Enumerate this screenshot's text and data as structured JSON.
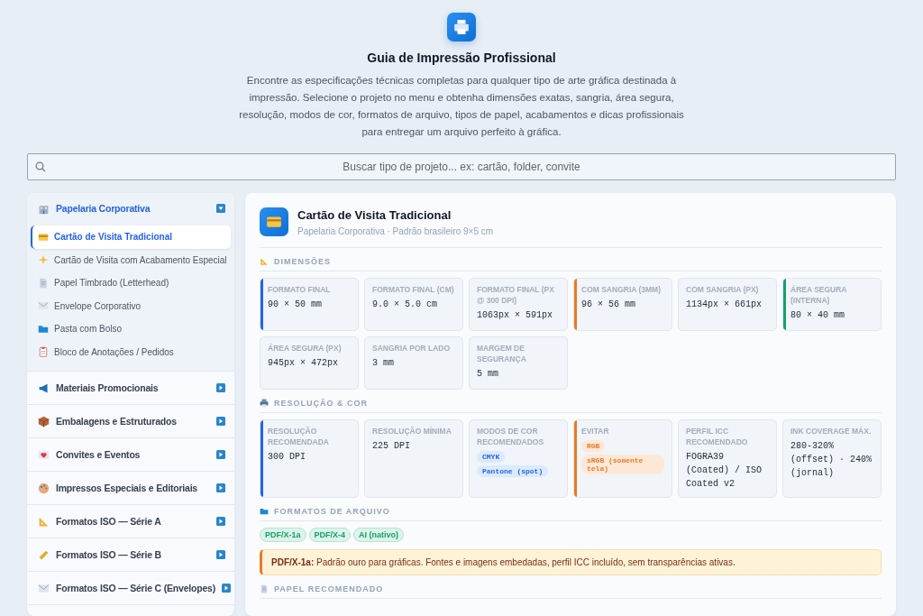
{
  "header": {
    "title": "Guia de Impressão Profissional",
    "intro": "Encontre as especificações técnicas completas para qualquer tipo de arte gráfica destinada à impressão. Selecione o projeto no menu e obtenha dimensões exatas, sangria, área segura, resolução, modos de cor, formatos de arquivo, tipos de papel, acabamentos e dicas profissionais para entregar um arquivo perfeito à gráfica."
  },
  "search": {
    "placeholder": "Buscar tipo de projeto... ex: cartão, folder, convite"
  },
  "sidebar": {
    "groups": [
      {
        "label": "Papelaria Corporativa",
        "expanded": true,
        "items": [
          {
            "label": "Cartão de Visita Tradicional",
            "selected": true
          },
          {
            "label": "Cartão de Visita com Acabamento Especial",
            "selected": false
          },
          {
            "label": "Papel Timbrado (Letterhead)",
            "selected": false
          },
          {
            "label": "Envelope Corporativo",
            "selected": false
          },
          {
            "label": "Pasta com Bolso",
            "selected": false
          },
          {
            "label": "Bloco de Anotações / Pedidos",
            "selected": false
          }
        ]
      },
      {
        "label": "Materiais Promocionais",
        "expanded": false
      },
      {
        "label": "Embalagens e Estruturados",
        "expanded": false
      },
      {
        "label": "Convites e Eventos",
        "expanded": false
      },
      {
        "label": "Impressos Especiais e Editoriais",
        "expanded": false
      },
      {
        "label": "Formatos ISO — Série A",
        "expanded": false
      },
      {
        "label": "Formatos ISO — Série B",
        "expanded": false
      },
      {
        "label": "Formatos ISO — Série C (Envelopes)",
        "expanded": false
      }
    ]
  },
  "detail": {
    "title": "Cartão de Visita Tradicional",
    "subtitle": "Papelaria Corporativa · Padrão brasileiro 9×5 cm",
    "sections": [
      {
        "heading": "DIMENSÕES",
        "cards": [
          {
            "label": "FORMATO FINAL",
            "kind": "text",
            "value": "90 × 50 mm",
            "color": "#2563eb"
          },
          {
            "label": "FORMATO FINAL (CM)",
            "kind": "text",
            "value": "9.0 × 5.0 cm"
          },
          {
            "label": "FORMATO FINAL (PX @ 300 DPI)",
            "kind": "text",
            "value": "1063px × 591px"
          },
          {
            "label": "COM SANGRIA (3MM)",
            "kind": "text",
            "value": "96 × 56 mm",
            "color": "#ea7a26"
          },
          {
            "label": "COM SANGRIA (PX)",
            "kind": "text",
            "value": "1134px × 661px"
          },
          {
            "label": "ÁREA SEGURA (INTERNA)",
            "kind": "text",
            "value": "80 × 40 mm",
            "color": "#16a06a"
          },
          {
            "label": "ÁREA SEGURA (PX)",
            "kind": "text",
            "value": "945px × 472px"
          },
          {
            "label": "SANGRIA POR LADO",
            "kind": "text",
            "value": "3 mm"
          },
          {
            "label": "MARGEM DE SEGURANÇA",
            "kind": "text",
            "value": "5 mm"
          }
        ]
      },
      {
        "heading": "RESOLUÇÃO & COR",
        "cards": [
          {
            "label": "RESOLUÇÃO RECOMENDADA",
            "kind": "text",
            "value": "300 DPI",
            "color": "#2563eb"
          },
          {
            "label": "RESOLUÇÃO MÍNIMA",
            "kind": "text",
            "value": "225 DPI"
          },
          {
            "label": "MODOS DE COR RECOMENDADOS",
            "kind": "tags",
            "tags": [
              "CMYK",
              "Pantone (spot)"
            ]
          },
          {
            "label": "EVITAR",
            "kind": "tags",
            "tags": [
              "RGB",
              "sRGB (somente tela)"
            ],
            "color": "#ea7a26"
          },
          {
            "label": "PERFIL ICC RECOMENDADO",
            "kind": "text",
            "value": "FOGRA39 (Coated) / ISO Coated v2"
          },
          {
            "label": "INK COVERAGE MÁX.",
            "kind": "text",
            "value": "280-320% (offset) · 240% (jornal)"
          }
        ]
      },
      {
        "heading": "FORMATOS DE ARQUIVO",
        "formats": [
          "PDF/X-1a",
          "PDF/X-4",
          "AI (nativo)"
        ],
        "note": "**PDF/X-1a:** Padrão ouro para gráficas. Fontes e imagens embedadas, perfil ICC incluído, sem transparências ativas."
      },
      {
        "heading": "PAPEL RECOMENDADO"
      }
    ]
  }
}
